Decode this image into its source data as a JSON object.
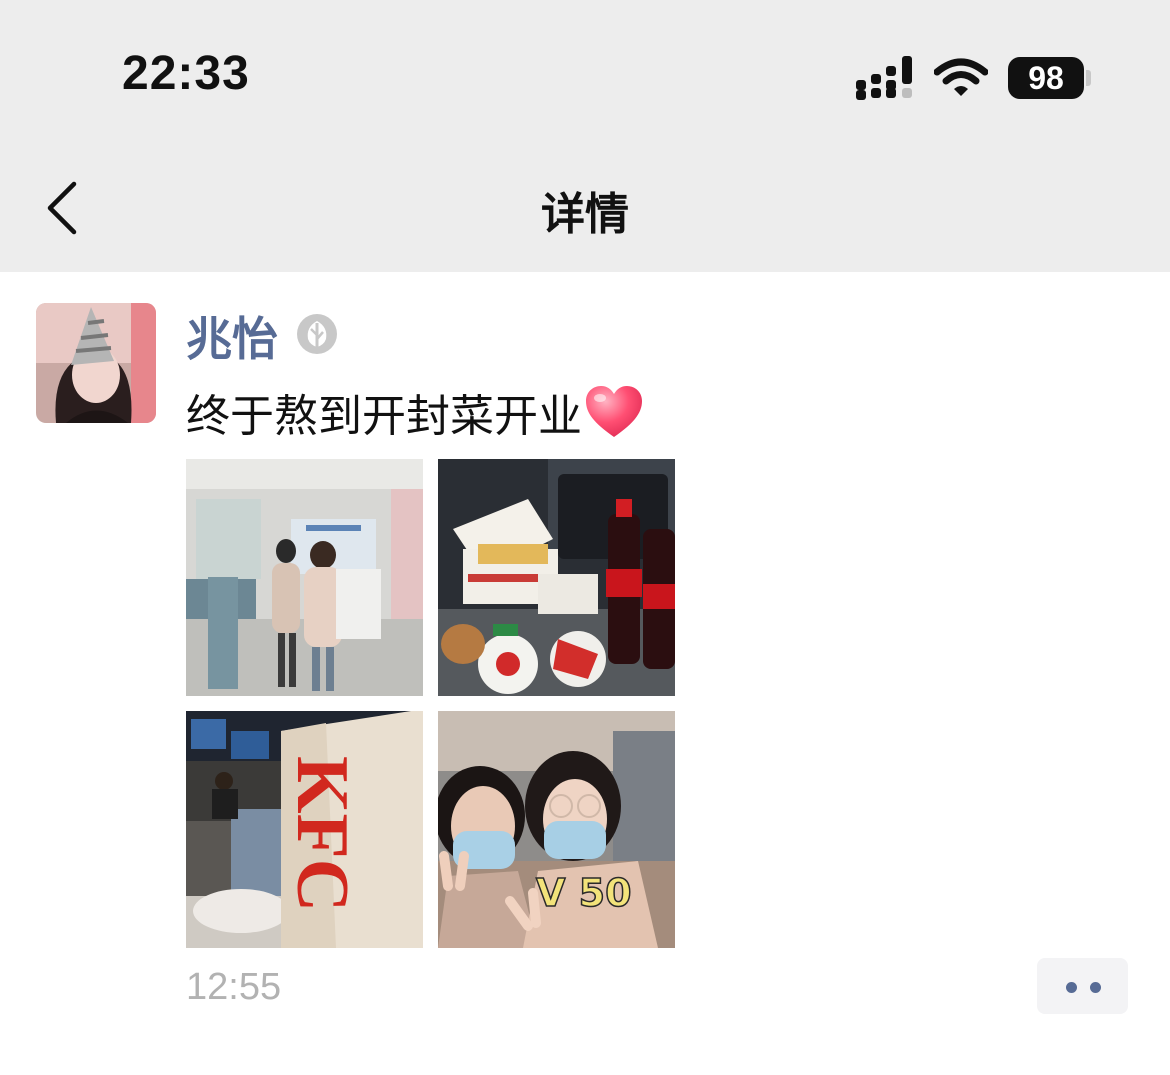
{
  "status_bar": {
    "time": "22:33",
    "battery": "98",
    "icons": [
      "signal-icon",
      "wifi-icon",
      "battery-icon"
    ]
  },
  "nav": {
    "title": "详情",
    "back_icon": "chevron-left-icon"
  },
  "post": {
    "username": "兆怡",
    "badge_icon": "leaf-badge-icon",
    "text": "终于熬到开封菜开业",
    "emoji": "heart-emoji",
    "photos": [
      {
        "name": "photo-two-people-corridor"
      },
      {
        "name": "photo-kfc-meal-cola"
      },
      {
        "name": "photo-kfc-bag"
      },
      {
        "name": "photo-selfie-v50",
        "overlay_text": "V 50"
      }
    ],
    "time": "12:55",
    "more_icon": "more-dots-icon"
  },
  "colors": {
    "name": "#576b95",
    "bar": "#ededed",
    "time": "#b2b2b2"
  }
}
